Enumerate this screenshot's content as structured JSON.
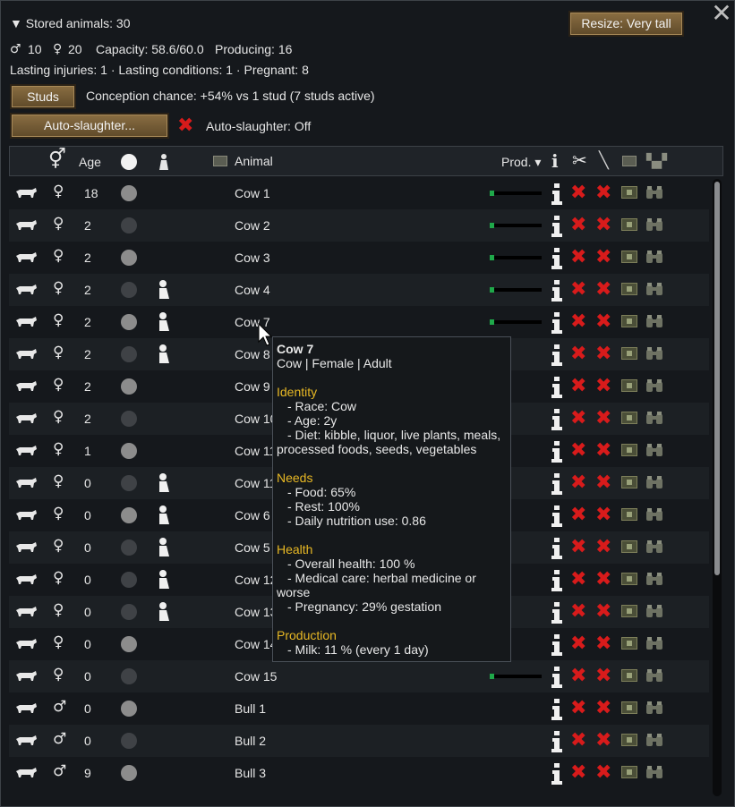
{
  "summary": {
    "stored_label": "▼ Stored animals: 30",
    "male_count": "10",
    "female_count": "20",
    "capacity": "Capacity: 58.6/60.0",
    "producing": "Producing: 16",
    "status_line": "Lasting injuries: 1 · Lasting conditions: 1 · Pregnant: 8",
    "conception": "Conception chance: +54% vs 1 stud (7 studs active)",
    "autoslaughter_status": "Auto-slaughter: Off"
  },
  "buttons": {
    "resize": "Resize: Very tall",
    "studs": "Studs",
    "autoslaughter": "Auto-slaughter..."
  },
  "columns": {
    "age": "Age",
    "animal": "Animal",
    "prod": "Prod. ▾"
  },
  "colors": {
    "accent_button": "#7a6038",
    "delete_red": "#d81b1b",
    "section_yellow": "#e8b824",
    "prod_green": "#1fa84a"
  },
  "rows": [
    {
      "name": "Cow 1",
      "sex": "female",
      "age": "18",
      "dot": "light",
      "pregnant": false,
      "prod": true
    },
    {
      "name": "Cow 2",
      "sex": "female",
      "age": "2",
      "dot": "dark",
      "pregnant": false,
      "prod": true
    },
    {
      "name": "Cow 3",
      "sex": "female",
      "age": "2",
      "dot": "light",
      "pregnant": false,
      "prod": true
    },
    {
      "name": "Cow 4",
      "sex": "female",
      "age": "2",
      "dot": "dark",
      "pregnant": true,
      "prod": true
    },
    {
      "name": "Cow 7",
      "sex": "female",
      "age": "2",
      "dot": "light",
      "pregnant": true,
      "prod": true
    },
    {
      "name": "Cow 8",
      "sex": "female",
      "age": "2",
      "dot": "dark",
      "pregnant": true,
      "prod": false
    },
    {
      "name": "Cow 9",
      "sex": "female",
      "age": "2",
      "dot": "light",
      "pregnant": false,
      "prod": false
    },
    {
      "name": "Cow 10",
      "sex": "female",
      "age": "2",
      "dot": "dark",
      "pregnant": false,
      "prod": false
    },
    {
      "name": "Cow 11",
      "sex": "female",
      "age": "1",
      "dot": "light",
      "pregnant": false,
      "prod": false
    },
    {
      "name": "Cow 11",
      "sex": "female",
      "age": "0",
      "dot": "dark",
      "pregnant": true,
      "prod": false
    },
    {
      "name": "Cow 6",
      "sex": "female",
      "age": "0",
      "dot": "light",
      "pregnant": true,
      "prod": false
    },
    {
      "name": "Cow 5",
      "sex": "female",
      "age": "0",
      "dot": "dark",
      "pregnant": true,
      "prod": false
    },
    {
      "name": "Cow 12",
      "sex": "female",
      "age": "0",
      "dot": "dark",
      "pregnant": true,
      "prod": false
    },
    {
      "name": "Cow 13",
      "sex": "female",
      "age": "0",
      "dot": "dark",
      "pregnant": true,
      "prod": false
    },
    {
      "name": "Cow 14",
      "sex": "female",
      "age": "0",
      "dot": "light",
      "pregnant": false,
      "prod": false
    },
    {
      "name": "Cow 15",
      "sex": "female",
      "age": "0",
      "dot": "dark",
      "pregnant": false,
      "prod": true
    },
    {
      "name": "Bull 1",
      "sex": "male",
      "age": "0",
      "dot": "light",
      "pregnant": false,
      "prod": false
    },
    {
      "name": "Bull 2",
      "sex": "male",
      "age": "0",
      "dot": "dark",
      "pregnant": false,
      "prod": false
    },
    {
      "name": "Bull 3",
      "sex": "male",
      "age": "9",
      "dot": "light",
      "pregnant": false,
      "prod": false
    }
  ],
  "tooltip": {
    "title": "Cow 7",
    "subtitle": "Cow | Female | Adult",
    "identity_header": "Identity",
    "race": "- Race: Cow",
    "age": "- Age: 2y",
    "diet": "- Diet: kibble, liquor, live plants, meals,",
    "diet2": "processed foods, seeds, vegetables",
    "needs_header": "Needs",
    "food": "- Food: 65%",
    "rest": "- Rest: 100%",
    "nutrition": "- Daily nutrition use: 0.86",
    "health_header": "Health",
    "overall": "- Overall health: 100 %",
    "medical": "- Medical care: herbal medicine or",
    "medical2": "worse",
    "pregnancy": "- Pregnancy: 29% gestation",
    "production_header": "Production",
    "milk": "- Milk: 11 % (every 1 day)"
  }
}
